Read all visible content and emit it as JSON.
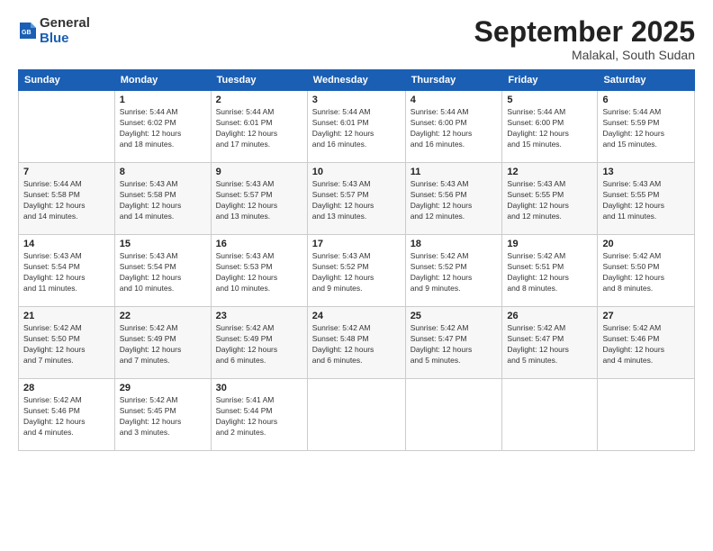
{
  "header": {
    "logo_line1": "General",
    "logo_line2": "Blue",
    "month": "September 2025",
    "location": "Malakal, South Sudan"
  },
  "columns": [
    "Sunday",
    "Monday",
    "Tuesday",
    "Wednesday",
    "Thursday",
    "Friday",
    "Saturday"
  ],
  "weeks": [
    [
      {
        "day": "",
        "info": ""
      },
      {
        "day": "1",
        "info": "Sunrise: 5:44 AM\nSunset: 6:02 PM\nDaylight: 12 hours\nand 18 minutes."
      },
      {
        "day": "2",
        "info": "Sunrise: 5:44 AM\nSunset: 6:01 PM\nDaylight: 12 hours\nand 17 minutes."
      },
      {
        "day": "3",
        "info": "Sunrise: 5:44 AM\nSunset: 6:01 PM\nDaylight: 12 hours\nand 16 minutes."
      },
      {
        "day": "4",
        "info": "Sunrise: 5:44 AM\nSunset: 6:00 PM\nDaylight: 12 hours\nand 16 minutes."
      },
      {
        "day": "5",
        "info": "Sunrise: 5:44 AM\nSunset: 6:00 PM\nDaylight: 12 hours\nand 15 minutes."
      },
      {
        "day": "6",
        "info": "Sunrise: 5:44 AM\nSunset: 5:59 PM\nDaylight: 12 hours\nand 15 minutes."
      }
    ],
    [
      {
        "day": "7",
        "info": "Sunrise: 5:44 AM\nSunset: 5:58 PM\nDaylight: 12 hours\nand 14 minutes."
      },
      {
        "day": "8",
        "info": "Sunrise: 5:43 AM\nSunset: 5:58 PM\nDaylight: 12 hours\nand 14 minutes."
      },
      {
        "day": "9",
        "info": "Sunrise: 5:43 AM\nSunset: 5:57 PM\nDaylight: 12 hours\nand 13 minutes."
      },
      {
        "day": "10",
        "info": "Sunrise: 5:43 AM\nSunset: 5:57 PM\nDaylight: 12 hours\nand 13 minutes."
      },
      {
        "day": "11",
        "info": "Sunrise: 5:43 AM\nSunset: 5:56 PM\nDaylight: 12 hours\nand 12 minutes."
      },
      {
        "day": "12",
        "info": "Sunrise: 5:43 AM\nSunset: 5:55 PM\nDaylight: 12 hours\nand 12 minutes."
      },
      {
        "day": "13",
        "info": "Sunrise: 5:43 AM\nSunset: 5:55 PM\nDaylight: 12 hours\nand 11 minutes."
      }
    ],
    [
      {
        "day": "14",
        "info": "Sunrise: 5:43 AM\nSunset: 5:54 PM\nDaylight: 12 hours\nand 11 minutes."
      },
      {
        "day": "15",
        "info": "Sunrise: 5:43 AM\nSunset: 5:54 PM\nDaylight: 12 hours\nand 10 minutes."
      },
      {
        "day": "16",
        "info": "Sunrise: 5:43 AM\nSunset: 5:53 PM\nDaylight: 12 hours\nand 10 minutes."
      },
      {
        "day": "17",
        "info": "Sunrise: 5:43 AM\nSunset: 5:52 PM\nDaylight: 12 hours\nand 9 minutes."
      },
      {
        "day": "18",
        "info": "Sunrise: 5:42 AM\nSunset: 5:52 PM\nDaylight: 12 hours\nand 9 minutes."
      },
      {
        "day": "19",
        "info": "Sunrise: 5:42 AM\nSunset: 5:51 PM\nDaylight: 12 hours\nand 8 minutes."
      },
      {
        "day": "20",
        "info": "Sunrise: 5:42 AM\nSunset: 5:50 PM\nDaylight: 12 hours\nand 8 minutes."
      }
    ],
    [
      {
        "day": "21",
        "info": "Sunrise: 5:42 AM\nSunset: 5:50 PM\nDaylight: 12 hours\nand 7 minutes."
      },
      {
        "day": "22",
        "info": "Sunrise: 5:42 AM\nSunset: 5:49 PM\nDaylight: 12 hours\nand 7 minutes."
      },
      {
        "day": "23",
        "info": "Sunrise: 5:42 AM\nSunset: 5:49 PM\nDaylight: 12 hours\nand 6 minutes."
      },
      {
        "day": "24",
        "info": "Sunrise: 5:42 AM\nSunset: 5:48 PM\nDaylight: 12 hours\nand 6 minutes."
      },
      {
        "day": "25",
        "info": "Sunrise: 5:42 AM\nSunset: 5:47 PM\nDaylight: 12 hours\nand 5 minutes."
      },
      {
        "day": "26",
        "info": "Sunrise: 5:42 AM\nSunset: 5:47 PM\nDaylight: 12 hours\nand 5 minutes."
      },
      {
        "day": "27",
        "info": "Sunrise: 5:42 AM\nSunset: 5:46 PM\nDaylight: 12 hours\nand 4 minutes."
      }
    ],
    [
      {
        "day": "28",
        "info": "Sunrise: 5:42 AM\nSunset: 5:46 PM\nDaylight: 12 hours\nand 4 minutes."
      },
      {
        "day": "29",
        "info": "Sunrise: 5:42 AM\nSunset: 5:45 PM\nDaylight: 12 hours\nand 3 minutes."
      },
      {
        "day": "30",
        "info": "Sunrise: 5:41 AM\nSunset: 5:44 PM\nDaylight: 12 hours\nand 2 minutes."
      },
      {
        "day": "",
        "info": ""
      },
      {
        "day": "",
        "info": ""
      },
      {
        "day": "",
        "info": ""
      },
      {
        "day": "",
        "info": ""
      }
    ]
  ]
}
